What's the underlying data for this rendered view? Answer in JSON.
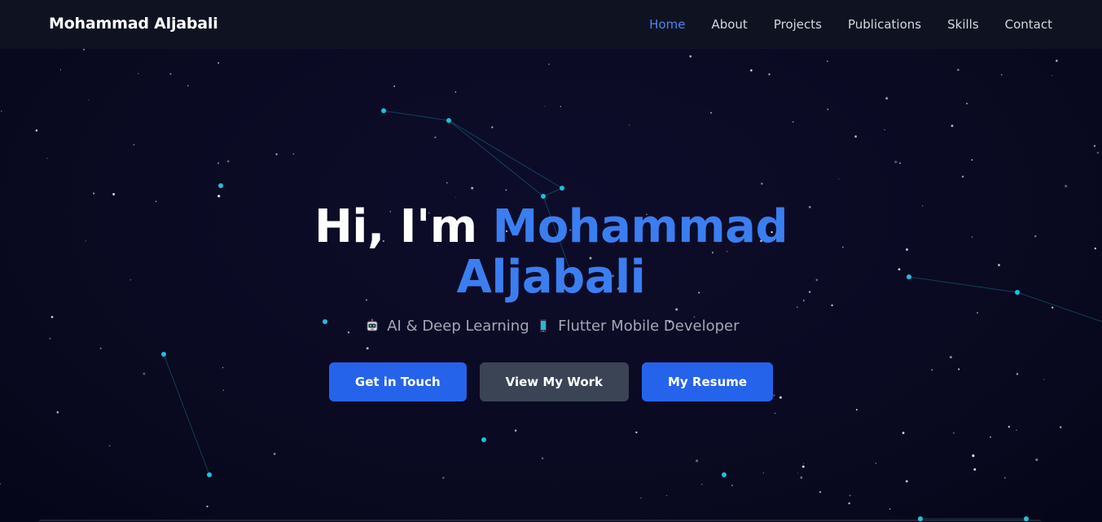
{
  "nav": {
    "brand": "Mohammad Aljabali",
    "links": [
      {
        "label": "Home",
        "active": true
      },
      {
        "label": "About",
        "active": false
      },
      {
        "label": "Projects",
        "active": false
      },
      {
        "label": "Publications",
        "active": false
      },
      {
        "label": "Skills",
        "active": false
      },
      {
        "label": "Contact",
        "active": false
      }
    ]
  },
  "hero": {
    "greeting": "Hi, I'm ",
    "name_first": "Mohammad",
    "name_last": "Aljabali",
    "subtitle_part1": "AI & Deep Learning",
    "subtitle_part2": "Flutter Mobile Developer",
    "icons": [
      "robot-icon",
      "mobile-phone-icon"
    ]
  },
  "buttons": {
    "contact": "Get in Touch",
    "work": "View My Work",
    "resume": "My Resume"
  },
  "colors": {
    "accent": "#3b7ef0",
    "primary_button": "#2563eb",
    "secondary_button": "#3b4454",
    "star_glow": "#19c3d8"
  }
}
